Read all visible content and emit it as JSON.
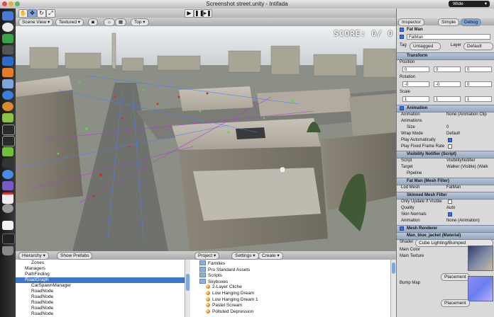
{
  "window": {
    "title": "Screenshot street.unity - Intifada"
  },
  "toolbar": {
    "tools": [
      "hand-tool",
      "move-tool",
      "rotate-tool",
      "scale-tool"
    ],
    "layout": "Wide"
  },
  "scene_view": {
    "mode": "Scene View",
    "shading": "Textured",
    "view": "Top",
    "score_text": "SCORE: 0/ 0"
  },
  "inspector": {
    "tabs": [
      "Inspector",
      "Simple",
      "Debug"
    ],
    "object_name_title": "Fat Man",
    "object_name_field": "FatMan",
    "tag_label": "Tag",
    "tag_value": "Untagged",
    "layer_label": "Layer",
    "layer_value": "Default",
    "transform": {
      "header": "Transform",
      "position_label": "Position",
      "position": [
        "0",
        "0",
        "0"
      ],
      "rotation_label": "Rotation",
      "rotation": [
        "-0",
        "-0",
        "0"
      ],
      "scale_label": "Scale",
      "scale": [
        "1",
        "1",
        "1"
      ]
    },
    "animation": {
      "header": "Animation",
      "rows": [
        {
          "label": "Animation",
          "value": "None (Animation Clip"
        },
        {
          "label": "Animations",
          "value": ""
        },
        {
          "label": "Size",
          "value": "0"
        },
        {
          "label": "Wrap Mode",
          "value": "Default"
        },
        {
          "label": "Play Automatically",
          "value": ""
        },
        {
          "label": "Play Fixed Frame Rate",
          "value": ""
        }
      ]
    },
    "visibility_notifier": {
      "header": "Visibility Notifier (Script)",
      "script_label": "Script",
      "script_value": "VisibilityNotifier",
      "target_label": "Target",
      "target_value": "Walker (Visible) (Walk",
      "pipeline_label": "Pipeline"
    },
    "mesh_filter": {
      "header": "Fat Man (Mesh Filter)",
      "lod_label": "Lod Mesh",
      "lod_value": "FatMan"
    },
    "skinned_mesh": {
      "header": "Skinned Mesh Filter",
      "rows": [
        {
          "label": "Only Update If Visible",
          "value": ""
        },
        {
          "label": "Quality",
          "value": "Auto"
        },
        {
          "label": "Skin Normals",
          "value": ""
        },
        {
          "label": "Animation",
          "value": "None (Animation)"
        }
      ]
    },
    "mesh_renderer": {
      "header": "Mesh Renderer"
    },
    "material": {
      "header": "Man_blue_jacket (Material)",
      "shader_label": "Shader",
      "shader_value": "Cube Lighting/Bumped",
      "main_color_label": "Main Color",
      "main_texture_label": "Main Texture",
      "placement_label": "Placement",
      "bump_label": "Bump Map",
      "placement2_label": "Placement"
    }
  },
  "hierarchy": {
    "tab": "Hierarchy",
    "button": "Show Prefabs",
    "items": [
      {
        "label": "Zones",
        "indent": 2,
        "selected": false
      },
      {
        "label": "Managers",
        "indent": 1,
        "selected": false
      },
      {
        "label": "PathFinding",
        "indent": 1,
        "selected": false
      },
      {
        "label": "RoadGraph",
        "indent": 1,
        "selected": true
      },
      {
        "label": "CarSpawnManager",
        "indent": 2,
        "selected": false
      },
      {
        "label": "RoadNode",
        "indent": 2,
        "selected": false
      },
      {
        "label": "RoadNode",
        "indent": 2,
        "selected": false
      },
      {
        "label": "RoadNode",
        "indent": 2,
        "selected": false
      },
      {
        "label": "RoadNode",
        "indent": 2,
        "selected": false
      },
      {
        "label": "RoadNode",
        "indent": 2,
        "selected": false
      }
    ]
  },
  "project": {
    "tab": "Project",
    "settings": "Settings",
    "create": "Create",
    "items": [
      {
        "label": "Families",
        "kind": "folder",
        "indent": 1
      },
      {
        "label": "Pro Standard Assets",
        "kind": "folder",
        "indent": 1
      },
      {
        "label": "Scripts",
        "kind": "folder",
        "indent": 1
      },
      {
        "label": "Skyboxes",
        "kind": "folder",
        "indent": 1
      },
      {
        "label": "2-Layer Cliche",
        "kind": "material",
        "indent": 2
      },
      {
        "label": "Low Hanging Dream",
        "kind": "material",
        "indent": 2
      },
      {
        "label": "Low Hanging Dream 1",
        "kind": "material",
        "indent": 2
      },
      {
        "label": "Pastel Scream",
        "kind": "material",
        "indent": 2
      },
      {
        "label": "Polluted Depression",
        "kind": "material",
        "indent": 2
      }
    ]
  },
  "colors": {
    "selection": "#3f75c9",
    "inspector_header": "#a5b3c6",
    "score_text": "#ffffff"
  }
}
